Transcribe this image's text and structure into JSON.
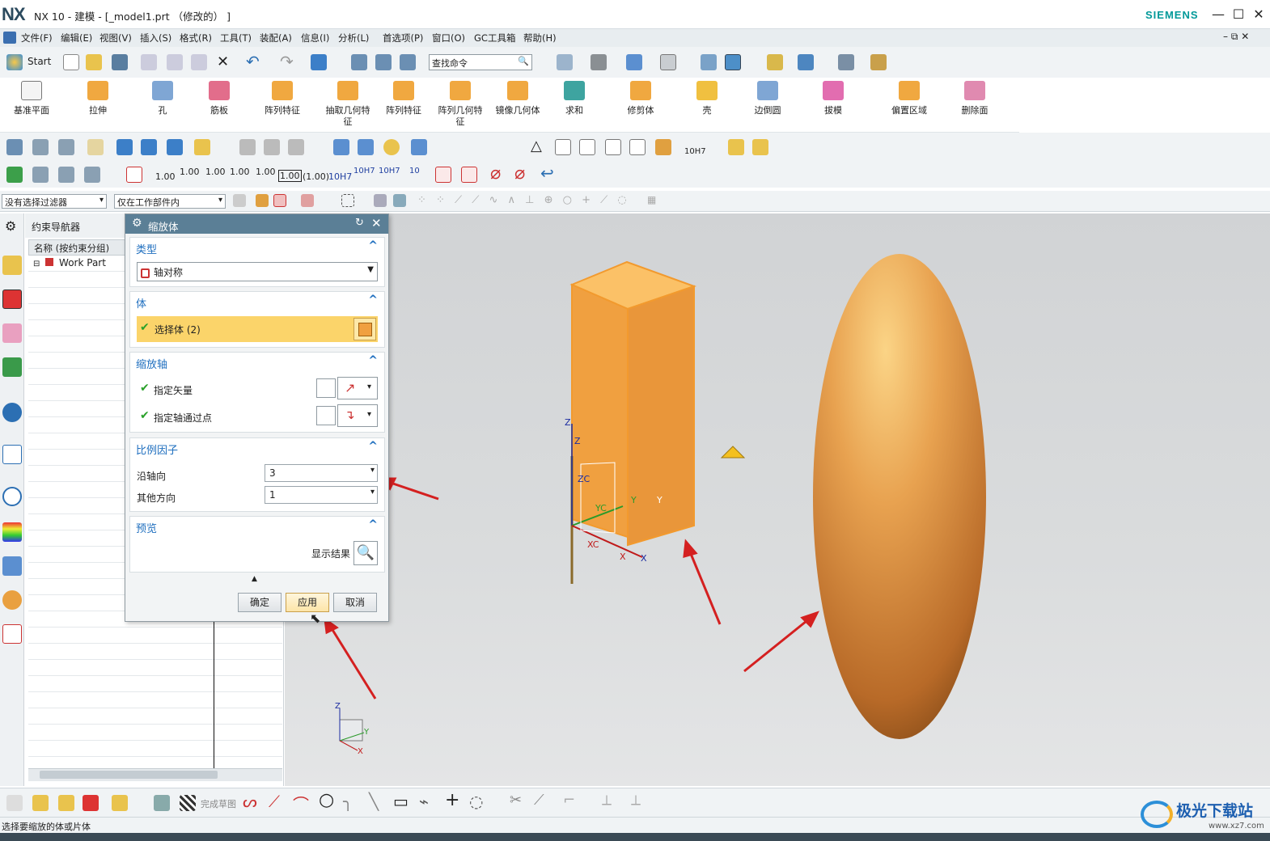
{
  "window": {
    "app_logo": "NX",
    "title": "NX 10 - 建模 - [_model1.prt （修改的） ]",
    "brand": "SIEMENS"
  },
  "menu": [
    "文件(F)",
    "编辑(E)",
    "视图(V)",
    "插入(S)",
    "格式(R)",
    "工具(T)",
    "装配(A)",
    "信息(I)",
    "分析(L)",
    "首选项(P)",
    "窗口(O)",
    "GC工具箱",
    "帮助(H)"
  ],
  "toolbar": {
    "start_label": "Start",
    "search_placeholder": "查找命令"
  },
  "ribbon": [
    {
      "label": "基准平面",
      "icon": "datum-plane-icon"
    },
    {
      "label": "拉伸",
      "icon": "extrude-icon"
    },
    {
      "label": "孔",
      "icon": "hole-icon"
    },
    {
      "label": "筋板",
      "icon": "rib-icon"
    },
    {
      "label": "阵列特征",
      "icon": "pattern-feature-icon"
    },
    {
      "label": "抽取几何特征",
      "icon": "extract-geometry-icon"
    },
    {
      "label": "阵列特征",
      "icon": "pattern-feature-icon"
    },
    {
      "label": "阵列几何特征",
      "icon": "pattern-geometry-icon"
    },
    {
      "label": "镜像几何体",
      "icon": "mirror-geometry-icon"
    },
    {
      "label": "求和",
      "icon": "unite-icon"
    },
    {
      "label": "修剪体",
      "icon": "trim-body-icon"
    },
    {
      "label": "壳",
      "icon": "shell-icon"
    },
    {
      "label": "边倒圆",
      "icon": "edge-blend-icon"
    },
    {
      "label": "拔模",
      "icon": "draft-icon"
    },
    {
      "label": "偏置区域",
      "icon": "offset-region-icon"
    },
    {
      "label": "删除面",
      "icon": "delete-face-icon"
    }
  ],
  "pmi": {
    "v1": "1.00",
    "v2": "1.00",
    "v3": "1.00",
    "v4": "1.00",
    "v5": "1.00",
    "v6": "1.00",
    "v7": "(1.00)",
    "v8": "10H7",
    "v9": "10H7",
    "v10": "10H7",
    "v11": "10",
    "fit": "10H7"
  },
  "filter": {
    "selection_filter": "没有选择过滤器",
    "scope": "仅在工作部件内"
  },
  "navigator": {
    "title": "约束导航器",
    "column": "名称 (按约束分组)",
    "item": "Work Part"
  },
  "dialog": {
    "title": "缩放体",
    "type_section": "类型",
    "type_value": "轴对称",
    "body_section": "体",
    "select_body": "选择体 (2)",
    "axis_section": "缩放轴",
    "specify_vector": "指定矢量",
    "specify_point": "指定轴通过点",
    "factor_section": "比例因子",
    "along_axis_label": "沿轴向",
    "along_axis_value": "3",
    "other_dir_label": "其他方向",
    "other_dir_value": "1",
    "preview_section": "预览",
    "show_result": "显示结果",
    "ok": "确定",
    "apply": "应用",
    "cancel": "取消"
  },
  "viewport": {
    "triad": {
      "zc": "ZC",
      "yc": "YC",
      "xc": "XC",
      "z": "Z",
      "y": "Y",
      "x": "X"
    },
    "mini_triad": {
      "z": "Z",
      "y": "Y",
      "x": "X"
    }
  },
  "bottom": {
    "finish_sketch": "完成草图"
  },
  "status": "选择要缩放的体或片体",
  "watermark": {
    "text": "极光下载站",
    "url": "www.xz7.com"
  },
  "colors": {
    "accent": "#1f6fbf",
    "body_orange": "#f0a040",
    "highlight": "#fbd46a",
    "dialog_header": "#5b7f96",
    "arrow": "#d42020"
  }
}
